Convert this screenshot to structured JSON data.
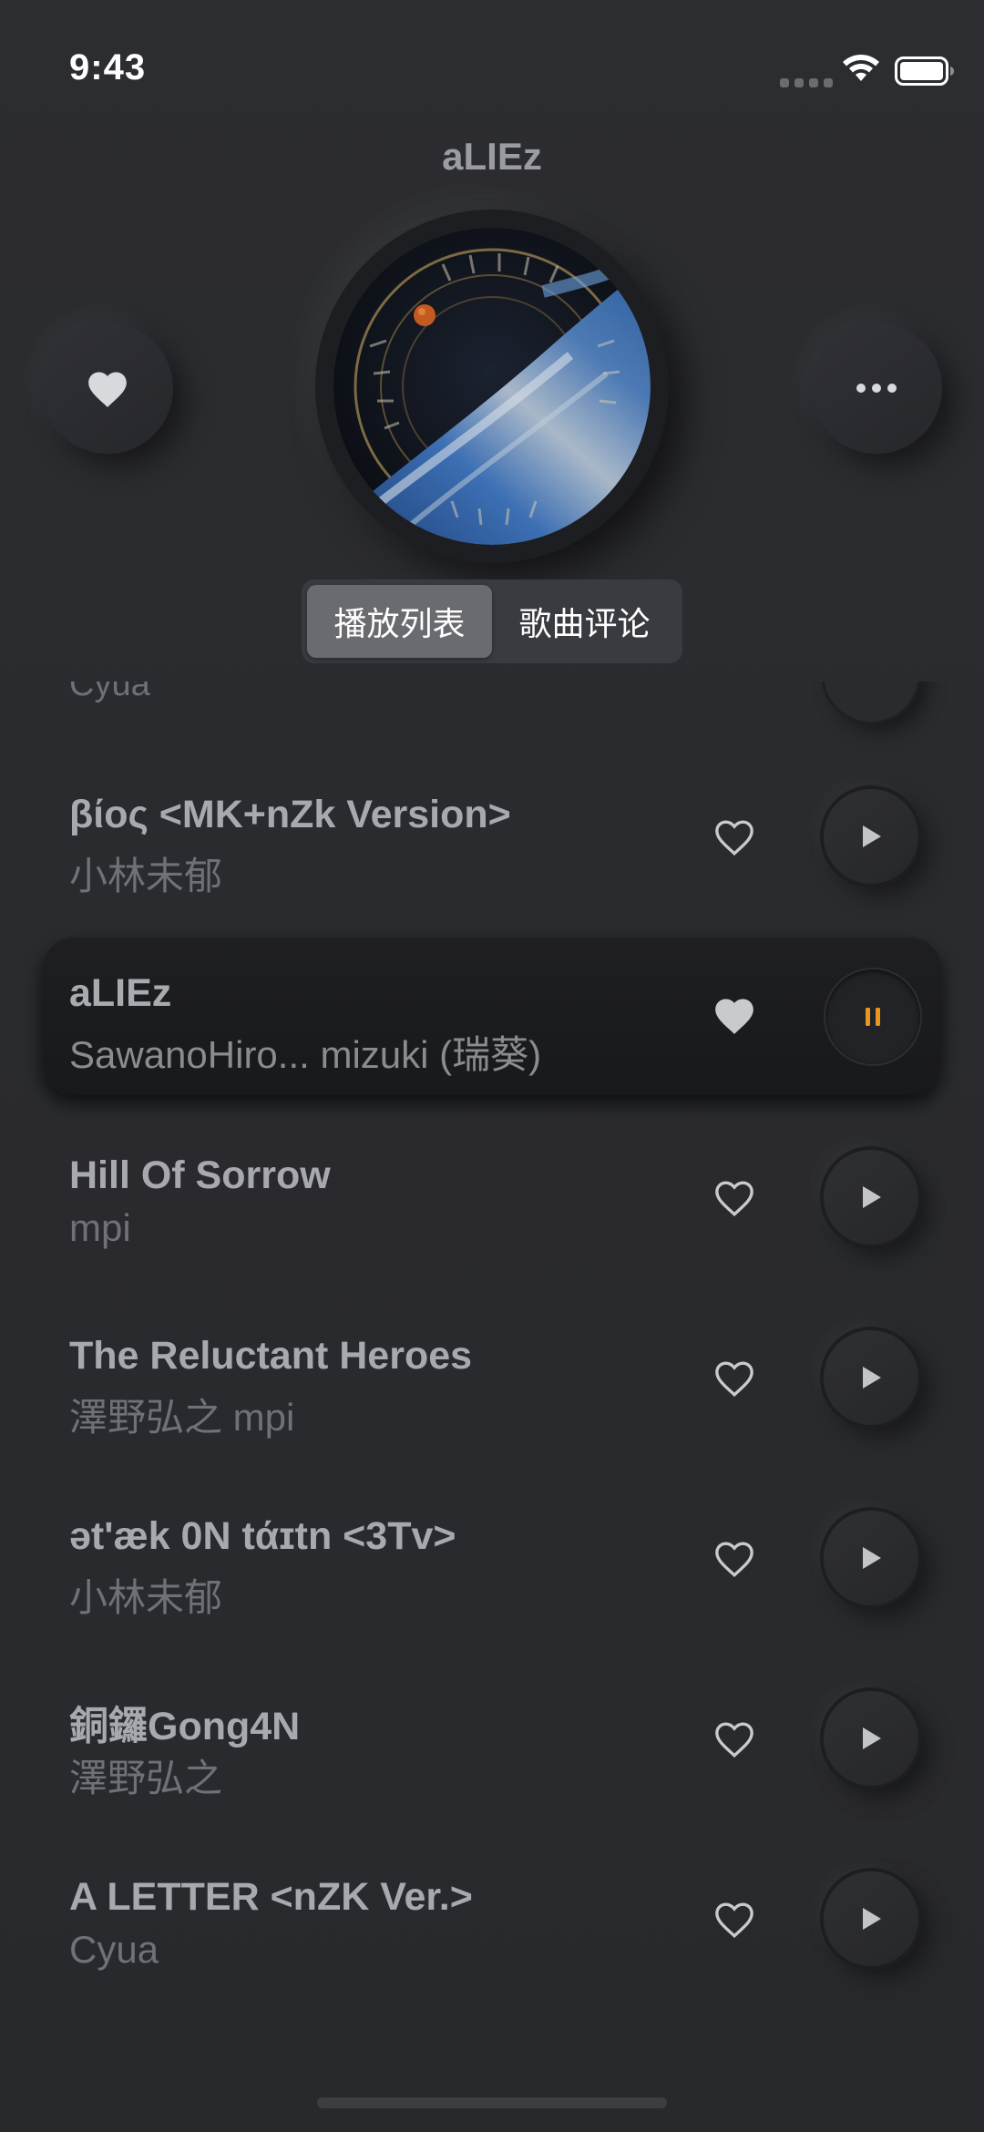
{
  "status_bar": {
    "time": "9:43"
  },
  "header": {
    "title": "aLIEz"
  },
  "tabs": [
    {
      "label": "播放列表",
      "active": true
    },
    {
      "label": "歌曲评论",
      "active": false
    }
  ],
  "partial_row": {
    "artist": "Cyua"
  },
  "songs": [
    {
      "title": "βίος <MK+nZk Version>",
      "artist": "小林未郁",
      "liked": false,
      "playing": false
    },
    {
      "title": "aLIEz",
      "artist": "SawanoHiro...  mizuki (瑞葵)",
      "liked": true,
      "playing": true
    },
    {
      "title": "Hill Of Sorrow",
      "artist": "mpi",
      "liked": false,
      "playing": false
    },
    {
      "title": "The Reluctant Heroes",
      "artist": "澤野弘之  mpi",
      "liked": false,
      "playing": false
    },
    {
      "title": "ət'æk 0N tάɪtn <3Tv>",
      "artist": "小林未郁",
      "liked": false,
      "playing": false
    },
    {
      "title": "銅鑼Gong4N",
      "artist": "澤野弘之",
      "liked": false,
      "playing": false
    },
    {
      "title": "A LETTER <nZK Ver.>",
      "artist": "Cyua",
      "liked": false,
      "playing": false
    }
  ],
  "colors": {
    "background": "#2b2c30",
    "accent_pause": "#e8961e",
    "title_text": "#a7a9ae",
    "artist_text": "#6f7176"
  },
  "icons": {
    "favorite": "heart-icon",
    "more": "ellipsis-icon",
    "like": "heart-outline-icon",
    "play": "play-icon",
    "pause": "pause-icon"
  }
}
